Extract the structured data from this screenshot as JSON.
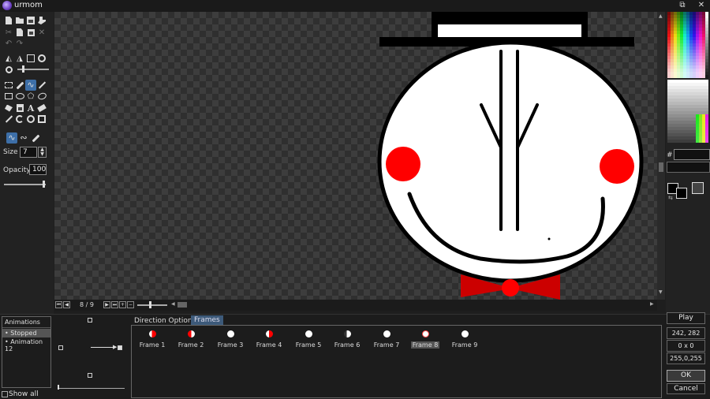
{
  "app": {
    "title": "urmom"
  },
  "toolbar": {
    "size_label": "Size",
    "size_value": "7",
    "opacity_label": "Opacity",
    "opacity_value": "100"
  },
  "palette": {
    "hex_label": "#",
    "hex_value": ""
  },
  "frame_nav": {
    "counter": "8 / 9"
  },
  "animations": {
    "header": "Animations",
    "items": [
      "Stopped",
      "Animation 12"
    ],
    "show_all_label": "Show all"
  },
  "tabs": [
    "Direction Options",
    "Frames"
  ],
  "frames": [
    "Frame 1",
    "Frame 2",
    "Frame 3",
    "Frame 4",
    "Frame 5",
    "Frame 6",
    "Frame 7",
    "Frame 8",
    "Frame 9"
  ],
  "selected_frame": "Frame 8",
  "right_panel": {
    "play_label": "Play",
    "position": "242, 282",
    "size": "0 x 0",
    "color": "255,0,255",
    "ok_label": "OK",
    "cancel_label": "Cancel"
  },
  "colors": {
    "accent": "#3d6fa8",
    "cheek": "#ff0000",
    "bowtie": "#cc0000"
  }
}
